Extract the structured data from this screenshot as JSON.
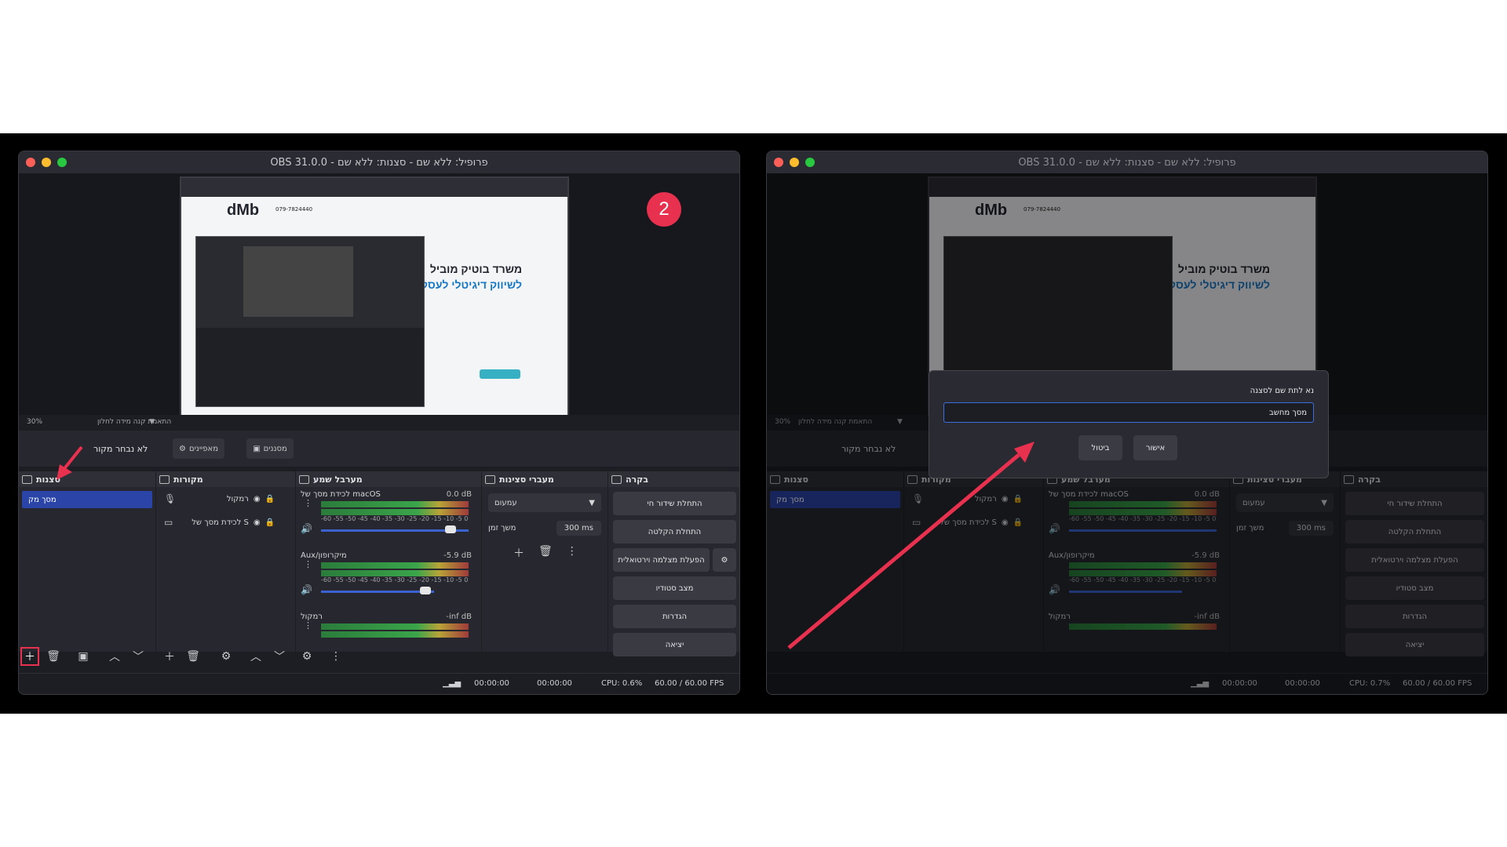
{
  "window": {
    "title": "OBS 31.0.0 - פרופיל: ללא שם - סצנות: ללא שם"
  },
  "preview": {
    "site_logo": "dMb",
    "site_phone": "079-7824440",
    "hero_line1": "משרד בוטיק מוביל",
    "hero_line2": "לשיווק דיגיטלי לעסקים",
    "step_badge": "2"
  },
  "zoom": {
    "percent": "30%",
    "scale_mode": "התאמת קנה מידה לחלון"
  },
  "context_bar": {
    "no_source": "לא נבחר מקור",
    "properties": "מאפיינים",
    "filters": "מסננים"
  },
  "docks": {
    "scenes": {
      "title": "סצנות",
      "items": [
        "מסך מק"
      ]
    },
    "sources": {
      "title": "מקורות",
      "items": [
        "רמקול",
        "לכידת מסך של S"
      ]
    },
    "mixer": {
      "title": "מערבל שמע",
      "channels": [
        {
          "name": "לכידת מסך של macOS",
          "db": "0.0 dB",
          "level": 0.95
        },
        {
          "name": "Aux/מיקרופון",
          "db": "-5.9 dB",
          "level": 0.75
        },
        {
          "name": "רמקול",
          "db": "-inf dB",
          "level": 0
        }
      ],
      "scale": "-60 -55 -50 -45 -40 -35 -30 -25 -20 -15 -10 -5 0"
    },
    "transitions": {
      "title": "מעברי סצינות",
      "selected": "עמעום",
      "duration_label": "משך זמן",
      "duration": "300 ms"
    },
    "controls": {
      "title": "בקרה",
      "buttons": [
        "התחלת שידור חי",
        "התחלת הקלטה",
        "הפעלת מצלמה וירטואלית",
        "מצב סטודיו",
        "הגדרות",
        "יציאה"
      ]
    }
  },
  "status": {
    "left": {
      "stream_time": "00:00:00",
      "rec_time": "00:00:00",
      "cpu": "CPU: 0.6%",
      "fps": "60.00 / 60.00 FPS"
    },
    "right": {
      "stream_time": "00:00:00",
      "rec_time": "00:00:00",
      "cpu": "CPU: 0.7%",
      "fps": "60.00 / 60.00 FPS"
    }
  },
  "dialog": {
    "prompt": "נא לתת שם לסצנה",
    "value": "מסך מחשב",
    "ok": "אישור",
    "cancel": "ביטול"
  },
  "colors": {
    "accent_blue": "#2b44a8",
    "annotation_red": "#e8304f"
  }
}
